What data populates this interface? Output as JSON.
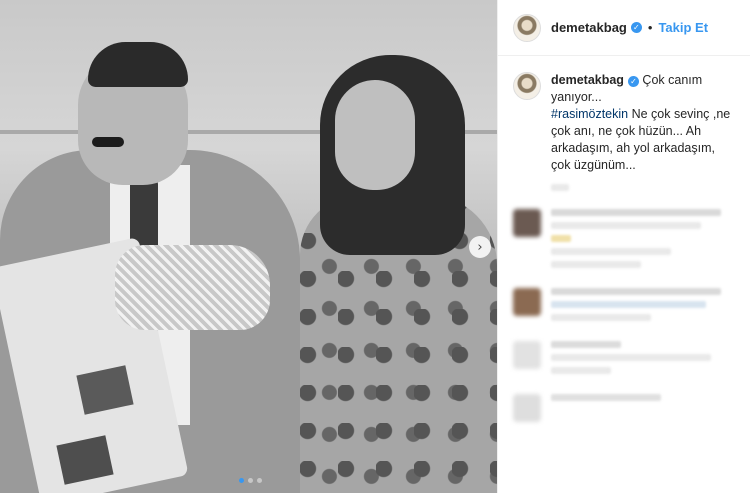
{
  "post": {
    "username": "demetakbag",
    "follow_label": "Takip Et",
    "bullet": "•",
    "caption": {
      "username": "demetakbag",
      "text_1": " Çok canım yanıyor...",
      "hashtag": "#rasimöztekin",
      "text_2": " Ne çok sevinç ,ne çok anı, ne çok hüzün... Ah arkadaşım, ah yol arkadaşım, çok üzgünüm..."
    }
  },
  "carousel": {
    "next_icon": "›",
    "slide_count": 3,
    "active_slide": 1
  },
  "colors": {
    "accent": "#3897f0",
    "text": "#262626",
    "hashtag": "#003569",
    "divider": "#efefef"
  },
  "icons": {
    "verified": "verified-badge-icon",
    "next": "chevron-right-icon"
  }
}
